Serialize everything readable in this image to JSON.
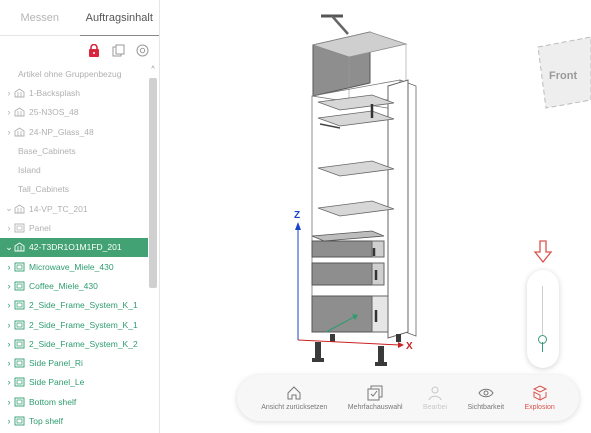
{
  "tabs": [
    {
      "label": "Messen",
      "active": false
    },
    {
      "label": "Auftragsinhalt",
      "active": true
    }
  ],
  "tree": [
    {
      "label": "Artikel ohne Gruppenbezug",
      "chevron": "",
      "icon": "",
      "style": "gray"
    },
    {
      "label": "1-Backsplash",
      "chevron": "›",
      "icon": "group",
      "style": "gray"
    },
    {
      "label": "25-N3OS_48",
      "chevron": "›",
      "icon": "group",
      "style": "gray"
    },
    {
      "label": "24-NP_Glass_48",
      "chevron": "›",
      "icon": "group",
      "style": "gray"
    },
    {
      "label": "Base_Cabinets",
      "chevron": "",
      "icon": "",
      "style": "gray"
    },
    {
      "label": "Island",
      "chevron": "",
      "icon": "",
      "style": "gray"
    },
    {
      "label": "Tall_Cabinets",
      "chevron": "",
      "icon": "",
      "style": "gray"
    },
    {
      "label": "14-VP_TC_201",
      "chevron": "⌄",
      "icon": "group",
      "style": "gray"
    },
    {
      "label": "Panel",
      "chevron": "›",
      "icon": "part",
      "style": "gray"
    },
    {
      "label": "42-T3DR1O1M1FD_201",
      "chevron": "⌄",
      "icon": "group",
      "style": "sel"
    },
    {
      "label": "Microwave_Miele_430",
      "chevron": "›",
      "icon": "part",
      "style": "green"
    },
    {
      "label": "Coffee_Miele_430",
      "chevron": "›",
      "icon": "part",
      "style": "green"
    },
    {
      "label": "2_Side_Frame_System_K_1",
      "chevron": "›",
      "icon": "part",
      "style": "green"
    },
    {
      "label": "2_Side_Frame_System_K_1",
      "chevron": "›",
      "icon": "part",
      "style": "green"
    },
    {
      "label": "2_Side_Frame_System_K_2",
      "chevron": "›",
      "icon": "part",
      "style": "green"
    },
    {
      "label": "Side Panel_Ri",
      "chevron": "›",
      "icon": "part",
      "style": "green"
    },
    {
      "label": "Side Panel_Le",
      "chevron": "›",
      "icon": "part",
      "style": "green"
    },
    {
      "label": "Bottom shelf",
      "chevron": "›",
      "icon": "part",
      "style": "green"
    },
    {
      "label": "Top shelf",
      "chevron": "›",
      "icon": "part",
      "style": "green"
    }
  ],
  "viewport": {
    "axis_z": "Z",
    "axis_x": "X",
    "view_cube_label": "Front"
  },
  "explosion_slider": {
    "level": 0.12
  },
  "toolbar": [
    {
      "label": "Ansicht zurücksetzen",
      "icon": "home-icon",
      "state": "normal"
    },
    {
      "label": "Mehrfachauswahl",
      "icon": "multi-select-icon",
      "state": "normal"
    },
    {
      "label": "Bearbei",
      "icon": "edit-icon",
      "state": "disabled"
    },
    {
      "label": "Sichtbarkeit",
      "icon": "eye-icon",
      "state": "normal"
    },
    {
      "label": "Explosion",
      "icon": "explosion-icon",
      "state": "active"
    }
  ],
  "colors": {
    "accent_green": "#43a274",
    "accent_red": "#d9534f",
    "lock_red": "#d9263c"
  }
}
